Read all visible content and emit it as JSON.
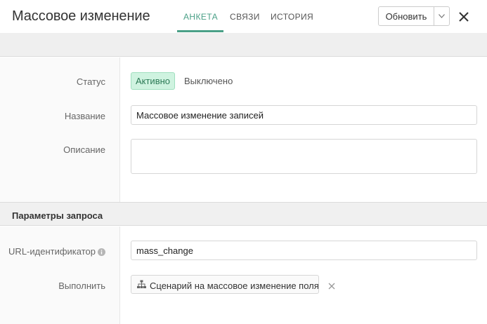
{
  "header": {
    "title": "Массовое изменение",
    "tabs": [
      {
        "label": "АНКЕТА",
        "active": true
      },
      {
        "label": "СВЯЗИ",
        "active": false
      },
      {
        "label": "ИСТОРИЯ",
        "active": false
      }
    ],
    "update_button": "Обновить",
    "icons": {
      "dropdown": "chevron-down-icon",
      "close": "close-icon"
    }
  },
  "form": {
    "status": {
      "label": "Статус",
      "options": [
        "Активно",
        "Выключено"
      ],
      "selected": "Активно"
    },
    "name": {
      "label": "Название",
      "value": "Массовое изменение записей"
    },
    "description": {
      "label": "Описание",
      "value": ""
    }
  },
  "query_params": {
    "section_title": "Параметры запроса",
    "url_id": {
      "label": "URL-идентификатор",
      "value": "mass_change",
      "icon": "info-icon"
    },
    "execute": {
      "label": "Выполнить",
      "value": "Сценарий на массовое изменение поля",
      "icon": "sitemap-icon",
      "remove_icon": "remove-icon"
    }
  },
  "colors": {
    "accent": "#4aa087",
    "active_status_bg": "#cff3e0",
    "active_status_text": "#2c7a56"
  }
}
